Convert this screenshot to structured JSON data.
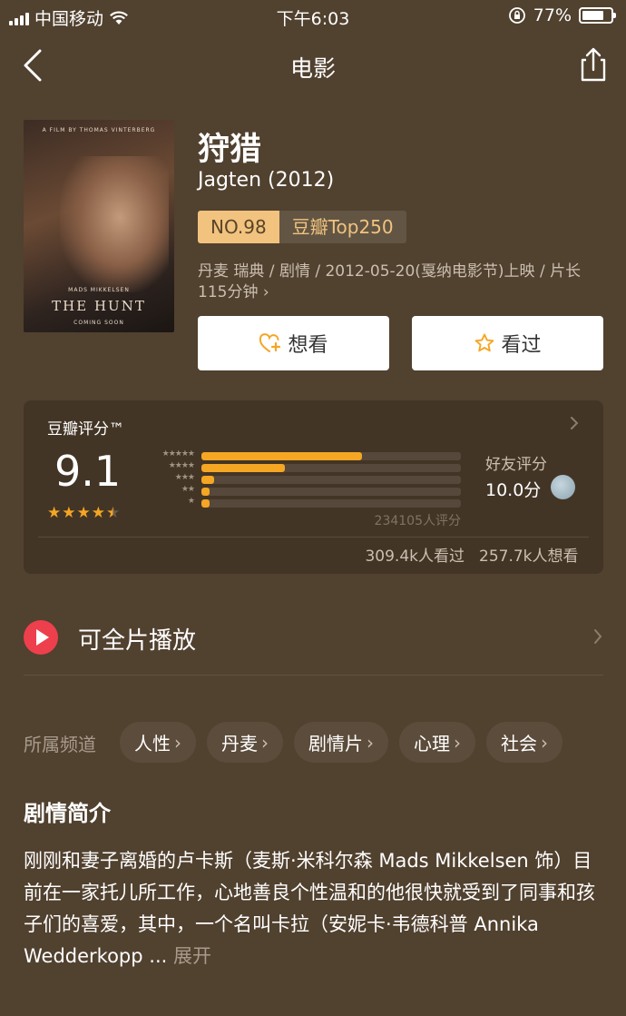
{
  "status_bar": {
    "carrier": "中国移动",
    "time": "下午6:03",
    "battery": "77%",
    "battery_level": 0.77
  },
  "nav": {
    "title": "电影",
    "back_icon": "chevron-left-icon",
    "share_icon": "share-icon"
  },
  "movie": {
    "poster": {
      "credit_line": "A FILM BY THOMAS VINTERBERG",
      "actor": "MADS MIKKELSEN",
      "title": "THE HUNT",
      "footer": "COMING SOON"
    },
    "title": "狩猎",
    "original_title": "Jagten (2012)",
    "rank_no": "NO.98",
    "rank_list": "豆瓣Top250",
    "meta": "丹麦 瑞典 / 剧情 / 2012-05-20(戛纳电影节)上映 / 片长115分钟 ›",
    "want_label": "想看",
    "seen_label": "看过"
  },
  "rating": {
    "label": "豆瓣评分™",
    "score": "9.1",
    "stars_value": 4.5,
    "star_rows": [
      "★★★★★",
      "★★★★",
      "★★★",
      "★★",
      "★"
    ],
    "distribution": [
      0.62,
      0.32,
      0.05,
      0.03,
      0.03
    ],
    "count": "234105人评分",
    "friend_label": "好友评分",
    "friend_score": "10.0分",
    "seen_count": "309.4k人看过",
    "want_count": "257.7k人想看"
  },
  "play": {
    "label": "可全片播放"
  },
  "channels": {
    "label": "所属频道",
    "items": [
      "人性",
      "丹麦",
      "剧情片",
      "心理",
      "社会"
    ]
  },
  "synopsis": {
    "title": "剧情简介",
    "text": "刚刚和妻子离婚的卢卡斯（麦斯·米科尔森 Mads Mikkelsen 饰）目前在一家托儿所工作，心地善良个性温和的他很快就受到了同事和孩子们的喜爱，其中，一个名叫卡拉（安妮卡·韦德科普 Annika Wedderkopp ... ",
    "expand": "展开"
  },
  "colors": {
    "background": "#51412f",
    "accent": "#f5a623",
    "badge": "#f1c37e",
    "play": "#ee3f4d"
  }
}
